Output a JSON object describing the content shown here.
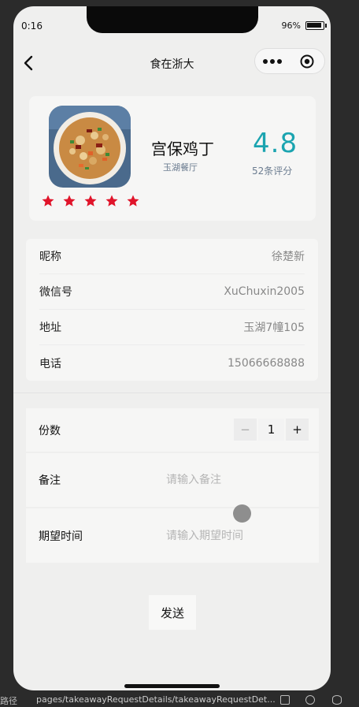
{
  "status_bar": {
    "time": "0:16",
    "battery": "96%"
  },
  "nav": {
    "title": "食在浙大"
  },
  "food": {
    "name": "宫保鸡丁",
    "restaurant": "玉湖餐厅",
    "rating": "4.8",
    "rating_count": "52条评分",
    "stars": 5,
    "star_color": "#e0142a",
    "rating_color": "#1ba4b0"
  },
  "info": [
    {
      "label": "昵称",
      "value": "徐楚新"
    },
    {
      "label": "微信号",
      "value": "XuChuxin2005"
    },
    {
      "label": "地址",
      "value": "玉湖7幢105"
    },
    {
      "label": "电话",
      "value": "15066668888"
    }
  ],
  "form": {
    "quantity_label": "份数",
    "quantity": "1",
    "minus": "−",
    "plus": "+",
    "note_label": "备注",
    "note_placeholder": "请输入备注",
    "time_label": "期望时间",
    "time_placeholder": "请输入期望时间"
  },
  "send_label": "发送",
  "devtools": {
    "path_label": "路径",
    "path": "pages/takeawayRequestDetails/takeawayRequestDet..."
  }
}
